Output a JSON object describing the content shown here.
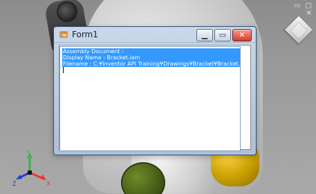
{
  "window": {
    "title": "Form1"
  },
  "textbox": {
    "lines": [
      "Assembly Document :",
      "Display Name : Bracket.iam",
      "Filename    : C:¥Inventor API Training¥Drawings¥Bracket¥Bracket.iam"
    ]
  },
  "axes": {
    "x_label": "X",
    "y_label": "Y",
    "z_label": "Z"
  },
  "icons": {
    "viewcube": "view-cube-icon"
  },
  "colors": {
    "selection": "#3399ff"
  }
}
